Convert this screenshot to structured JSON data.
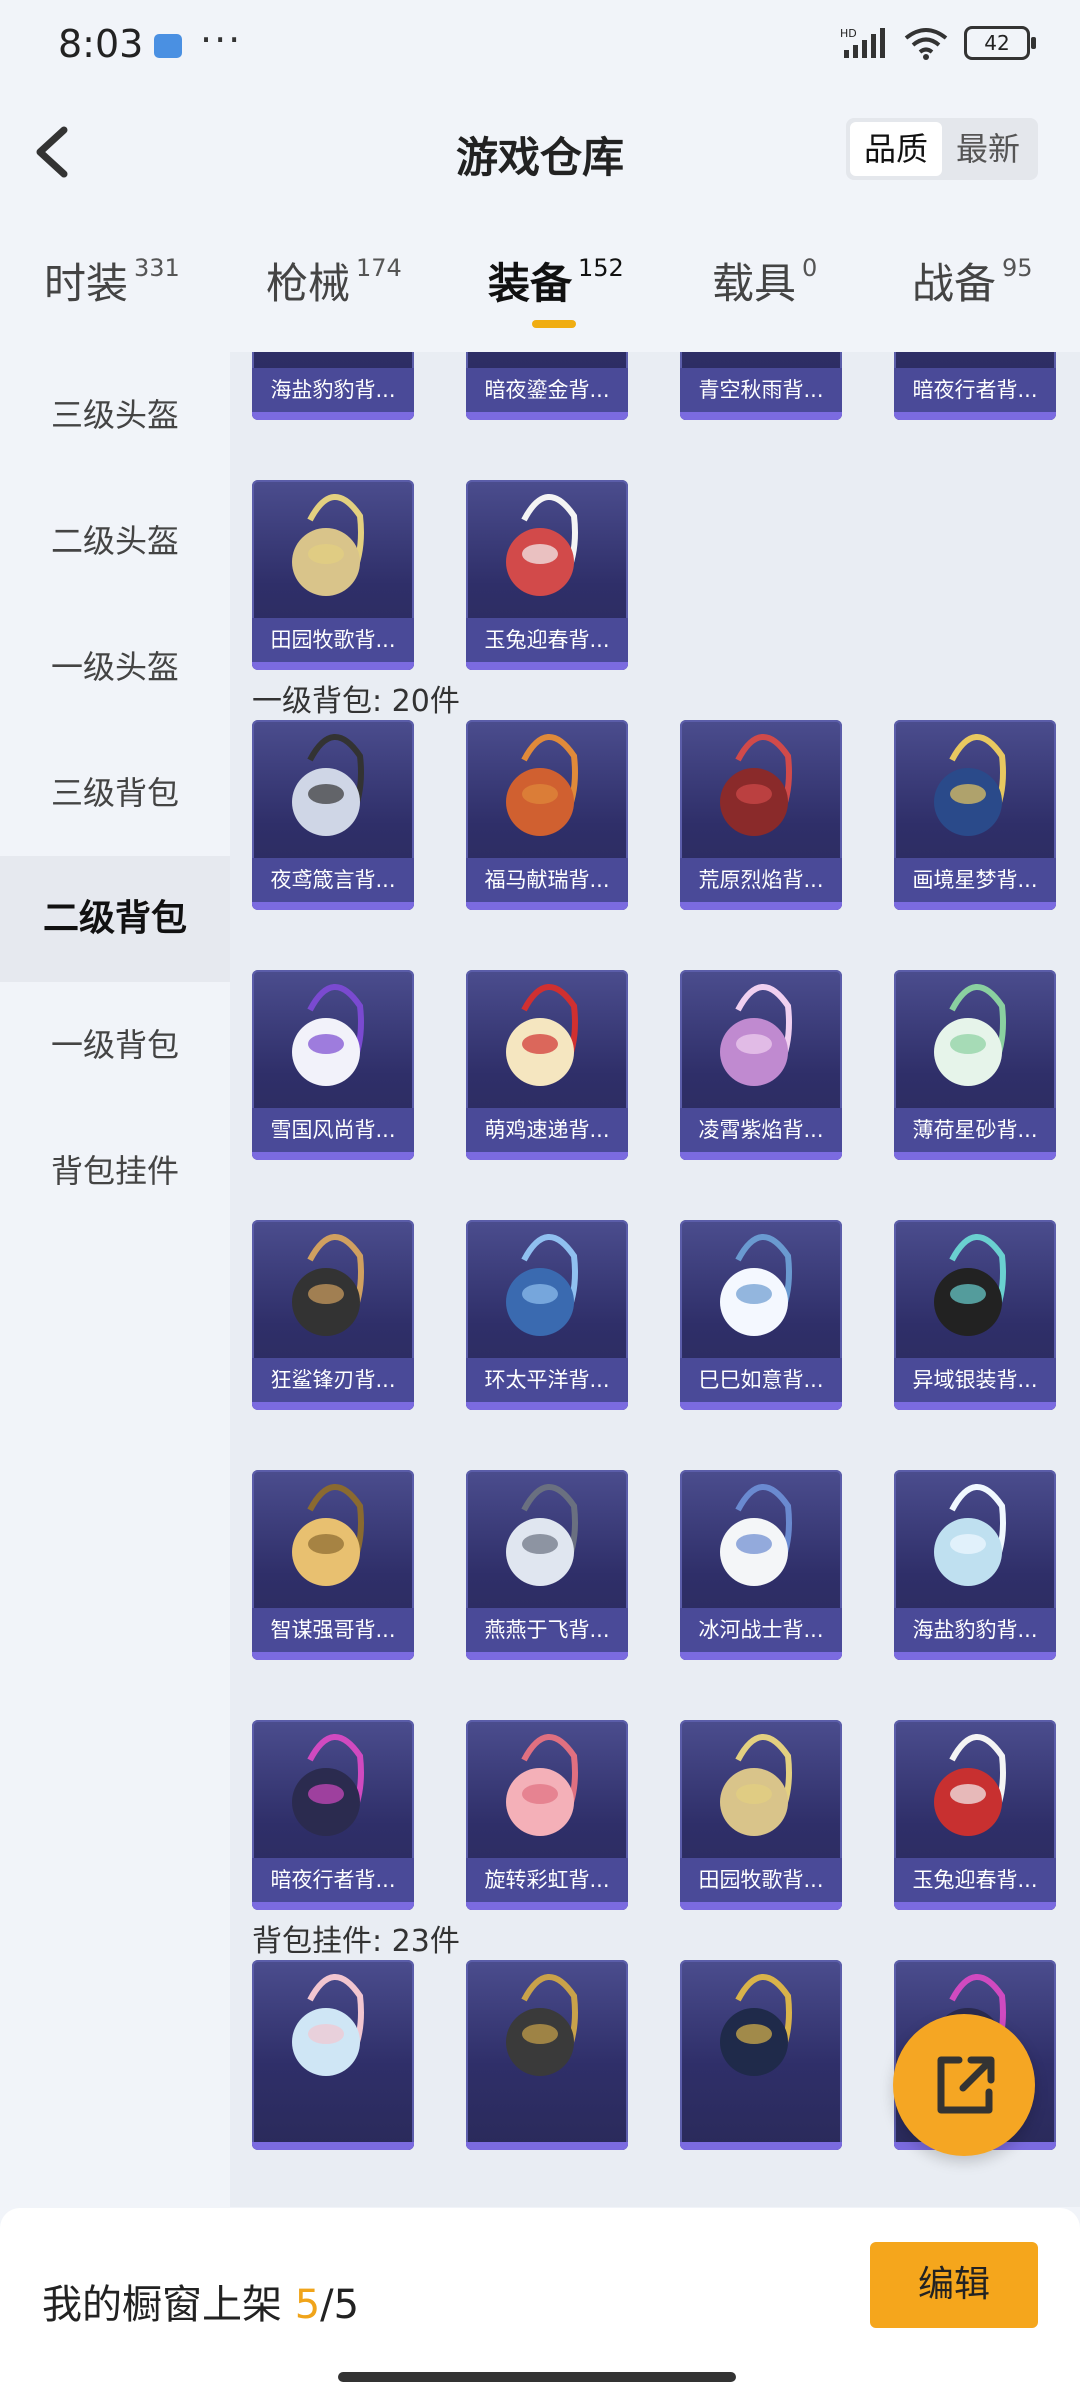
{
  "status": {
    "time": "8:03",
    "more": "···",
    "battery": "42",
    "network": "HD"
  },
  "header": {
    "title": "游戏仓库",
    "sort": [
      "品质",
      "最新"
    ],
    "sort_active": 0
  },
  "tabs": [
    {
      "label": "时装",
      "count": "331"
    },
    {
      "label": "枪械",
      "count": "174"
    },
    {
      "label": "装备",
      "count": "152",
      "active": true
    },
    {
      "label": "载具",
      "count": "0"
    },
    {
      "label": "战备",
      "count": "95"
    }
  ],
  "sidebar": {
    "items": [
      "三级头盔",
      "二级头盔",
      "一级头盔",
      "三级背包",
      "二级背包",
      "一级背包",
      "背包挂件"
    ],
    "active": 4
  },
  "sections": [
    {
      "title": "",
      "items": [
        "海盐豹豹背...",
        "暗夜鎏金背...",
        "青空秋雨背...",
        "暗夜行者背...",
        "田园牧歌背...",
        "玉兔迎春背..."
      ]
    },
    {
      "title": "一级背包: 20件",
      "items": [
        "夜鸢箴言背...",
        "福马献瑞背...",
        "荒原烈焰背...",
        "画境星梦背...",
        "雪国风尚背...",
        "萌鸡速递背...",
        "凌霄紫焰背...",
        "薄荷星砂背...",
        "狂鲨锋刃背...",
        "环太平洋背...",
        "巳巳如意背...",
        "异域银装背...",
        "智谋强哥背...",
        "燕燕于飞背...",
        "冰河战士背...",
        "海盐豹豹背...",
        "暗夜行者背...",
        "旋转彩虹背...",
        "田园牧歌背...",
        "玉兔迎春背..."
      ]
    },
    {
      "title": "背包挂件: 23件",
      "items": [
        "",
        "",
        "",
        ""
      ]
    }
  ],
  "bottom": {
    "label": "我的橱窗上架 ",
    "current": "5",
    "sep": "/",
    "total": "5",
    "edit": "编辑"
  },
  "colors": {
    "accent": "#f5a623",
    "card_bg": "#2f2f69",
    "card_label": "#4a4a98"
  }
}
